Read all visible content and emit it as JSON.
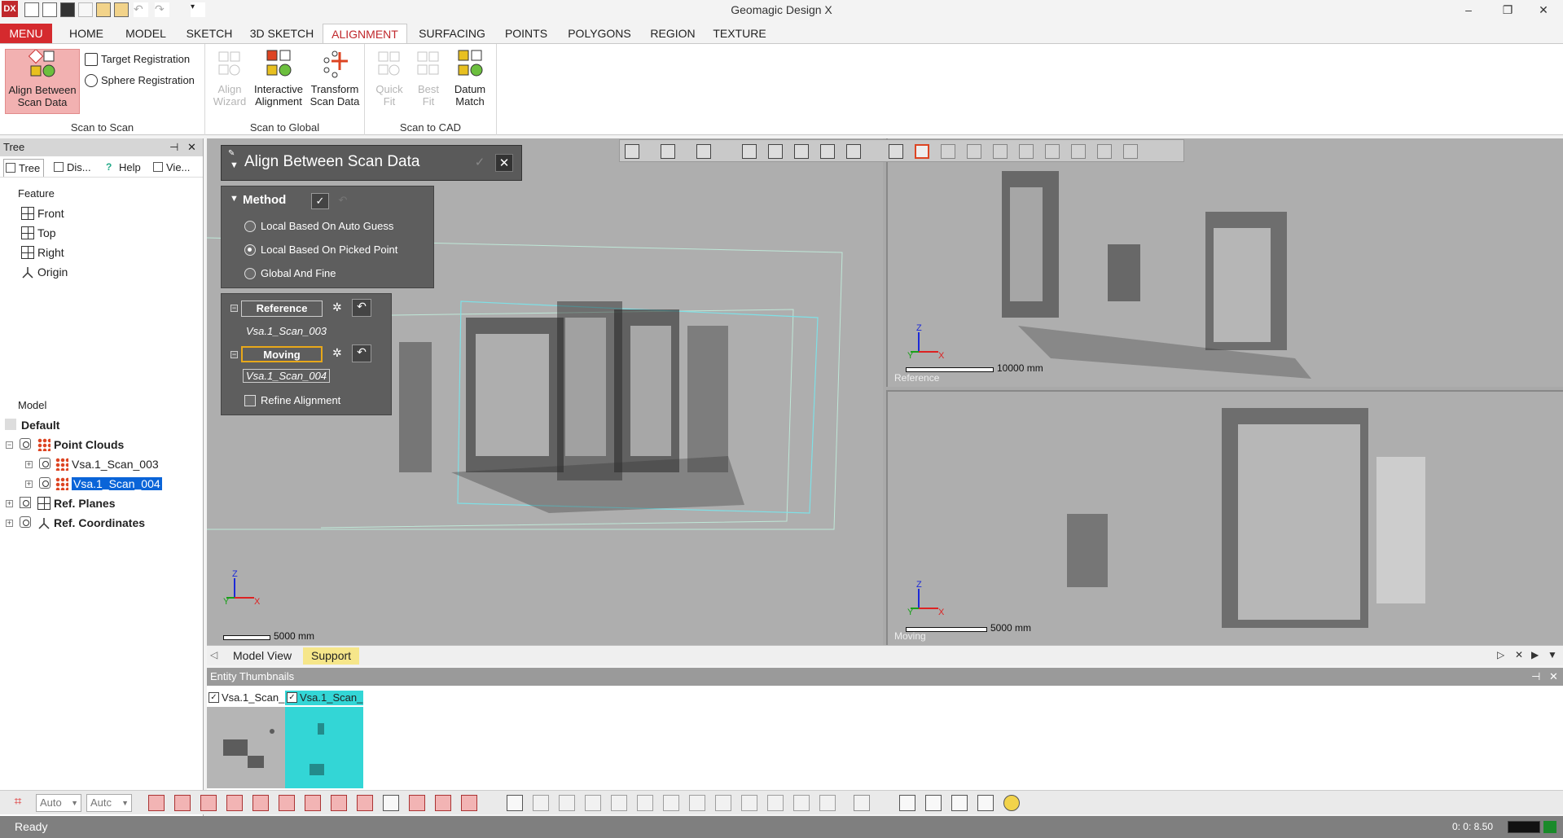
{
  "window": {
    "app_logo": "DX",
    "title": "Geomagic Design X",
    "minimize": "–",
    "maximize": "❐",
    "close": "✕"
  },
  "ribbon_tabs": [
    {
      "label": "MENU"
    },
    {
      "label": "HOME"
    },
    {
      "label": "MODEL"
    },
    {
      "label": "SKETCH"
    },
    {
      "label": "3D SKETCH"
    },
    {
      "label": "ALIGNMENT"
    },
    {
      "label": "SURFACING"
    },
    {
      "label": "POINTS"
    },
    {
      "label": "POLYGONS"
    },
    {
      "label": "REGION"
    },
    {
      "label": "TEXTURE"
    }
  ],
  "ribbon": {
    "scan_to_scan": {
      "label": "Scan to Scan",
      "align_between": "Align Between\nScan Data",
      "target_registration": "Target Registration",
      "sphere_registration": "Sphere Registration"
    },
    "scan_to_global": {
      "label": "Scan to Global",
      "align_wizard": "Align\nWizard",
      "interactive_alignment": "Interactive\nAlignment",
      "transform_scan": "Transform\nScan Data"
    },
    "scan_to_cad": {
      "label": "Scan to CAD",
      "quick_fit": "Quick\nFit",
      "best_fit": "Best\nFit",
      "datum_match": "Datum\nMatch"
    }
  },
  "tree_panel": {
    "header": "Tree",
    "pin": "⊣",
    "close": "✕",
    "tabs": [
      {
        "label": "Tree"
      },
      {
        "label": "Dis..."
      },
      {
        "label": "Help"
      },
      {
        "label": "Vie..."
      }
    ],
    "feature_label": "Feature",
    "features": [
      "Front",
      "Top",
      "Right",
      "Origin"
    ],
    "model_label": "Model",
    "model": {
      "default": "Default",
      "point_clouds": "Point Clouds",
      "scan_003": "Vsa.1_Scan_003",
      "scan_004": "Vsa.1_Scan_004",
      "ref_planes": "Ref. Planes",
      "ref_coords": "Ref. Coordinates"
    }
  },
  "align_dialog": {
    "title": "Align Between Scan Data",
    "ok": "✓",
    "cancel": "✕",
    "method": {
      "title": "Method",
      "options": [
        {
          "label": "Local Based On Auto Guess",
          "selected": false
        },
        {
          "label": "Local Based On Picked Point",
          "selected": true
        },
        {
          "label": "Global And Fine",
          "selected": false
        }
      ]
    },
    "reference_label": "Reference",
    "reference_value": "Vsa.1_Scan_003",
    "moving_label": "Moving",
    "moving_value": "Vsa.1_Scan_004",
    "refine_label": "Refine Alignment",
    "refine_checked": false
  },
  "viewports": {
    "main_scale": "5000 mm",
    "ref_scale": "10000 mm",
    "ref_label": "Reference",
    "moving_scale": "5000 mm",
    "moving_label": "Moving",
    "axis_x": "X",
    "axis_y": "Y",
    "axis_z": "Z"
  },
  "view_tabs": [
    {
      "label": "Model View"
    },
    {
      "label": "Support"
    }
  ],
  "thumbnails": {
    "header": "Entity Thumbnails",
    "items": [
      {
        "label": "Vsa.1_Scan_",
        "checked": true
      },
      {
        "label": "Vsa.1_Scan_",
        "checked": true
      }
    ]
  },
  "bottom_toolbar": {
    "combo1": "Auto",
    "combo2": "Autc"
  },
  "status": {
    "text": "Ready",
    "time": "0: 0: 8.50"
  },
  "colors": {
    "accent_red": "#d52a2e",
    "selected_blue": "#0a64d8",
    "moving_highlight": "#e8a81a",
    "thumb_selected": "#33d6d6"
  }
}
